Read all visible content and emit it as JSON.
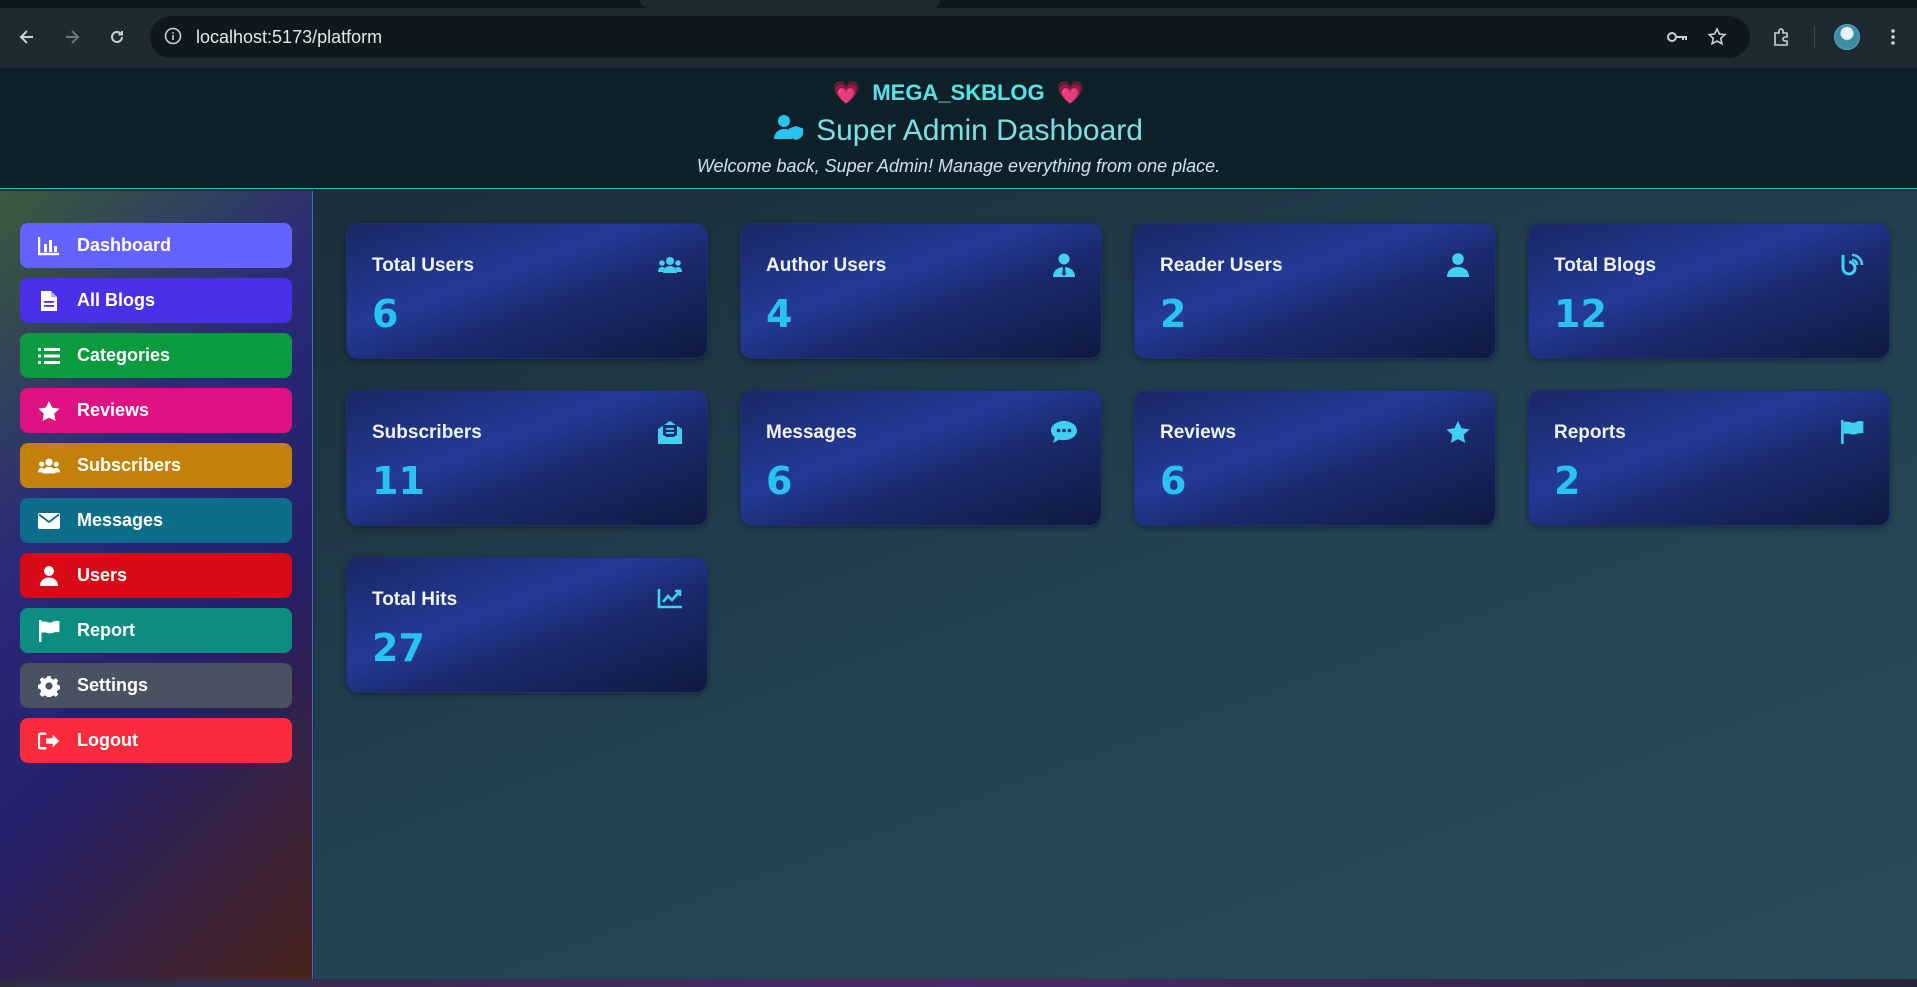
{
  "browser": {
    "url": "localhost:5173/platform"
  },
  "header": {
    "brand": "MEGA_SKBLOG",
    "heart_left": "💗",
    "heart_right": "💗",
    "title": "Super Admin Dashboard",
    "welcome": "Welcome back, Super Admin! Manage everything from one place."
  },
  "sidebar": {
    "items": [
      {
        "label": "Dashboard",
        "icon": "chart-bar-icon",
        "color": "#6363ff"
      },
      {
        "label": "All Blogs",
        "icon": "file-icon",
        "color": "#4a30e6"
      },
      {
        "label": "Categories",
        "icon": "list-icon",
        "color": "#0c9a3f"
      },
      {
        "label": "Reviews",
        "icon": "star-icon",
        "color": "#de1282"
      },
      {
        "label": "Subscribers",
        "icon": "users-icon",
        "color": "#c38109"
      },
      {
        "label": "Messages",
        "icon": "envelope-icon",
        "color": "#0c6e8a"
      },
      {
        "label": "Users",
        "icon": "user-icon",
        "color": "#d90a18"
      },
      {
        "label": "Report",
        "icon": "flag-icon",
        "color": "#0d8c82"
      },
      {
        "label": "Settings",
        "icon": "gear-icon",
        "color": "#4a5161"
      },
      {
        "label": "Logout",
        "icon": "logout-icon",
        "color": "#fb2a3c"
      }
    ]
  },
  "stats": [
    {
      "label": "Total Users",
      "value": "6",
      "icon": "users-icon"
    },
    {
      "label": "Author Users",
      "value": "4",
      "icon": "user-tie-icon"
    },
    {
      "label": "Reader Users",
      "value": "2",
      "icon": "user-icon"
    },
    {
      "label": "Total Blogs",
      "value": "12",
      "icon": "blog-icon"
    },
    {
      "label": "Subscribers",
      "value": "11",
      "icon": "envelope-open-icon"
    },
    {
      "label": "Messages",
      "value": "6",
      "icon": "comment-icon"
    },
    {
      "label": "Reviews",
      "value": "6",
      "icon": "star-icon"
    },
    {
      "label": "Reports",
      "value": "2",
      "icon": "flag-icon"
    },
    {
      "label": "Total Hits",
      "value": "27",
      "icon": "chart-line-icon"
    }
  ]
}
